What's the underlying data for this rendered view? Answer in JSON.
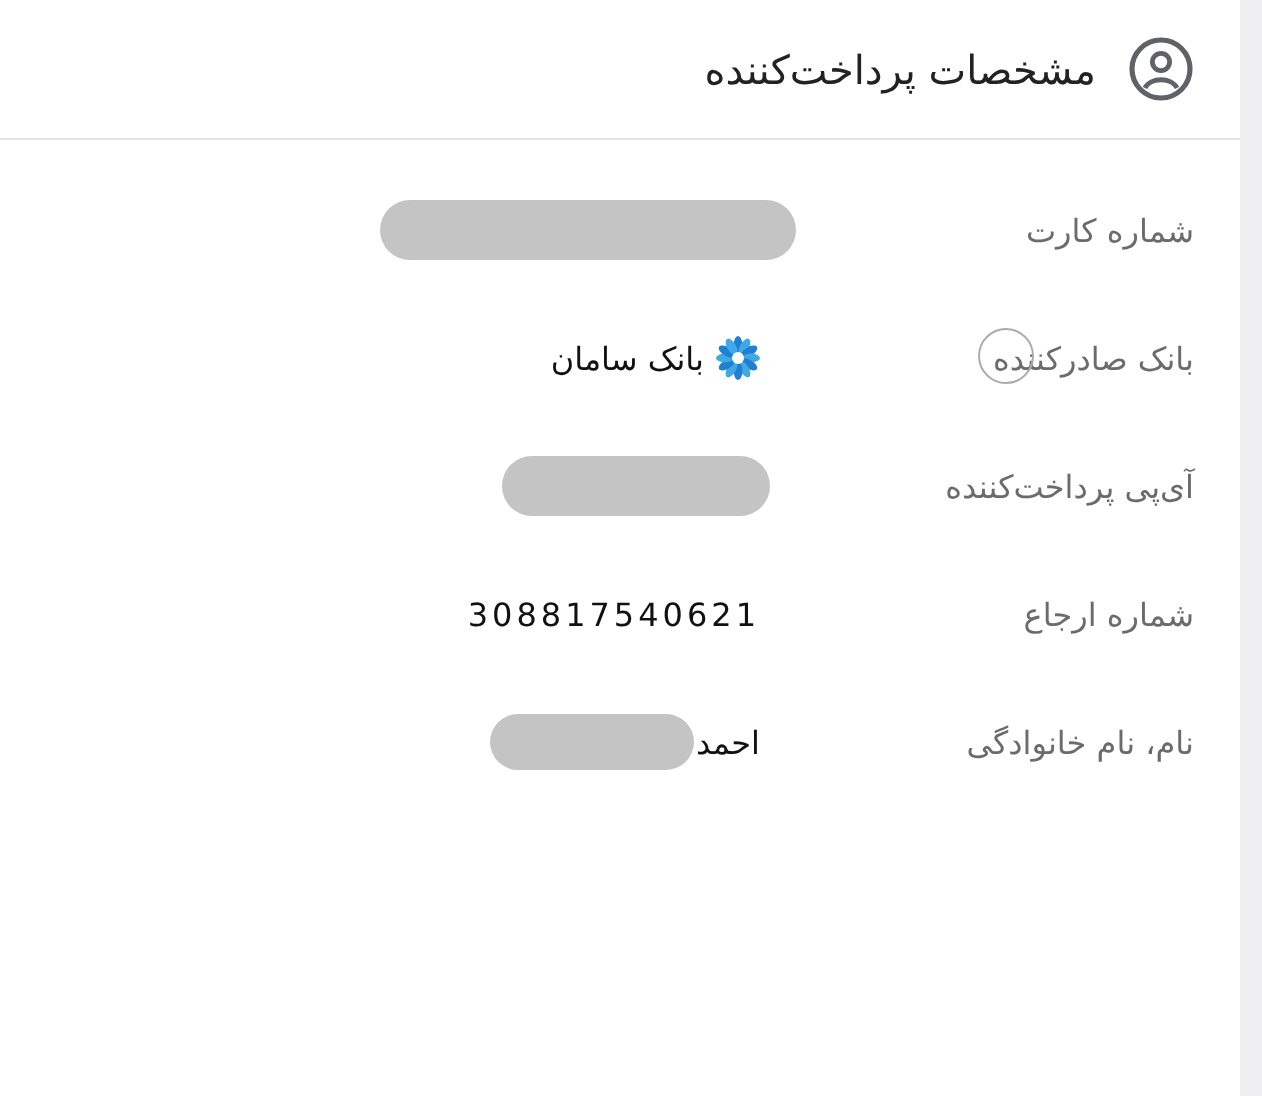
{
  "header": {
    "title": "مشخصات پرداخت‌کننده"
  },
  "rows": [
    {
      "label": "شماره کارت",
      "kind": "masked"
    },
    {
      "label": "بانک صادرکننده",
      "kind": "bank",
      "value": "بانک سامان",
      "cursor_ring": true
    },
    {
      "label": "آی‌پی پرداخت‌کننده",
      "kind": "masked"
    },
    {
      "label": "شماره ارجاع",
      "kind": "number",
      "value": "308817540621"
    },
    {
      "label": "نام، نام خانوادگی",
      "kind": "masked_text",
      "value": "احمد"
    }
  ]
}
